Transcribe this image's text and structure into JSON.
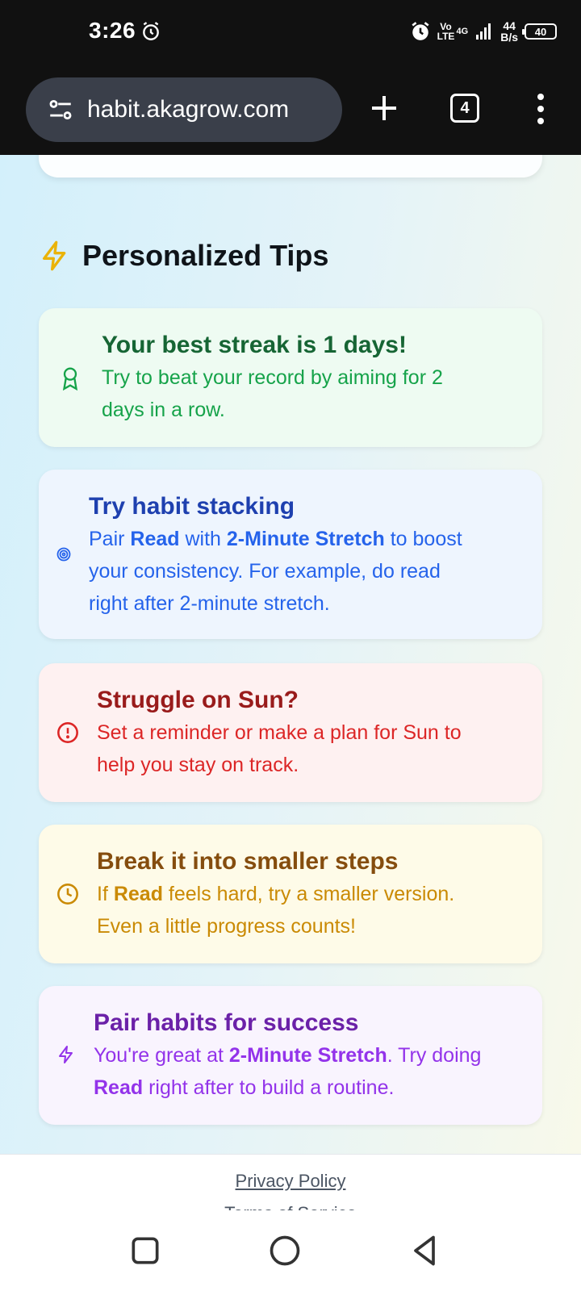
{
  "status_bar": {
    "time": "3:26",
    "network": "Vo LTE",
    "network_gen": "4G",
    "speed_value": "44",
    "speed_unit": "B/s",
    "battery": "40"
  },
  "browser": {
    "url": "habit.akagrow.com",
    "tab_count": "4"
  },
  "section": {
    "title": "Personalized Tips",
    "icon": "lightning-bolt-icon"
  },
  "tips": [
    {
      "icon": "award-ribbon-icon",
      "title": "Your best streak is 1 days!",
      "text": [
        "Try to beat your record by aiming for 2",
        "days in a row."
      ],
      "color": "#16a34a"
    },
    {
      "icon": "target-icon",
      "title": "Try habit stacking",
      "text_parts": [
        "Pair ",
        "Read",
        " with ",
        "2-Minute Stretch",
        " to boost",
        "your consistency. For example, do read",
        "right after 2-minute stretch."
      ],
      "color": "#2563eb"
    },
    {
      "icon": "alert-circle-icon",
      "title": "Struggle on Sun?",
      "text": [
        "Set a reminder or make a plan for Sun to",
        "help you stay on track."
      ],
      "color": "#dc2626"
    },
    {
      "icon": "clock-icon",
      "title": "Break it into smaller steps",
      "text_parts": [
        "If ",
        "Read",
        " feels hard, try a smaller version.",
        "Even a little progress counts!"
      ],
      "color": "#ca8a04"
    },
    {
      "icon": "lightning-icon",
      "title": "Pair habits for success",
      "text_parts": [
        "You're great at ",
        "2-Minute Stretch",
        ". Try doing",
        "Read",
        " right after to build a routine."
      ],
      "color": "#9333ea"
    }
  ],
  "footer": {
    "privacy": "Privacy Policy",
    "terms": "Terms of Service"
  }
}
